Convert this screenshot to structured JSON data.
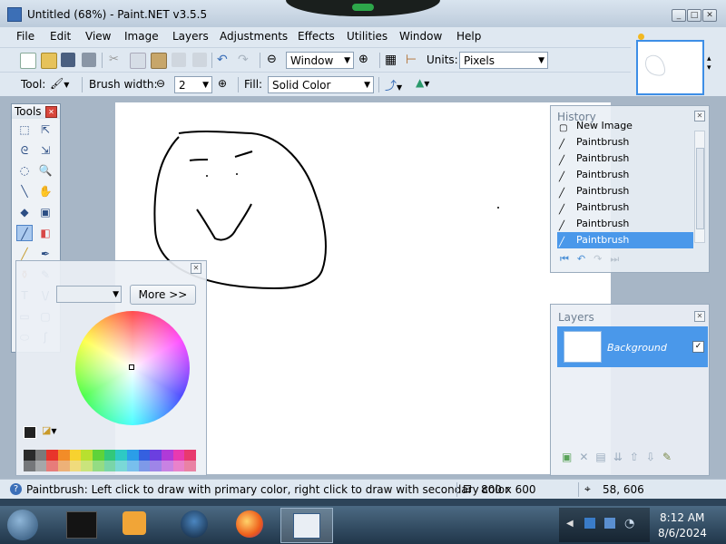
{
  "window": {
    "title": "Untitled (68%) - Paint.NET v3.5.5"
  },
  "menu": [
    "File",
    "Edit",
    "View",
    "Image",
    "Layers",
    "Adjustments",
    "Effects",
    "Utilities",
    "Window",
    "Help"
  ],
  "toolbar1": {
    "zoom_value": "Window",
    "units_label": "Units:",
    "units_value": "Pixels"
  },
  "toolbar2": {
    "tool_label": "Tool:",
    "brush_width_label": "Brush width:",
    "brush_width_value": "2",
    "fill_label": "Fill:",
    "fill_value": "Solid Color"
  },
  "tools_panel": {
    "title": "Tools",
    "selected_tool": "paintbrush"
  },
  "colors_panel": {
    "more_label": "More >>"
  },
  "history_panel": {
    "title": "History",
    "items": [
      "New Image",
      "Paintbrush",
      "Paintbrush",
      "Paintbrush",
      "Paintbrush",
      "Paintbrush",
      "Paintbrush",
      "Paintbrush"
    ],
    "selected_index": 7
  },
  "layers_panel": {
    "title": "Layers",
    "layers": [
      {
        "name": "Background",
        "visible": true
      }
    ]
  },
  "status": {
    "hint": "Paintbrush: Left click to draw with primary color, right click to draw with secondary color",
    "image_size": "800 x 600",
    "cursor_pos": "58, 606"
  },
  "taskbar": {
    "time": "8:12 AM",
    "date": "8/6/2024"
  },
  "palette": [
    "#2b2b2b",
    "#7a7a7a",
    "#e8342b",
    "#f28c28",
    "#f7d22f",
    "#b8e02f",
    "#5ed33a",
    "#32c87a",
    "#2ec9c4",
    "#2b9ee8",
    "#3560e0",
    "#6b3fe0",
    "#b03ad8",
    "#e83ab0",
    "#e83a6e"
  ],
  "colors": {
    "accent": "#3d8ee6",
    "selection": "#4a98ea"
  }
}
